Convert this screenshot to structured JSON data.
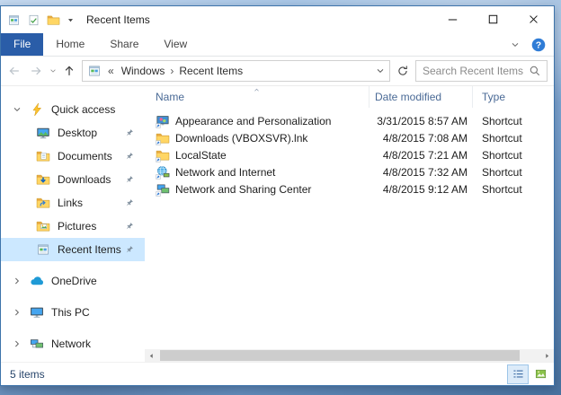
{
  "window": {
    "title": "Recent Items"
  },
  "ribbon": {
    "tabs": [
      {
        "label": "File",
        "active": true
      },
      {
        "label": "Home",
        "active": false
      },
      {
        "label": "Share",
        "active": false
      },
      {
        "label": "View",
        "active": false
      }
    ]
  },
  "addressbar": {
    "overflow": "«",
    "crumb_separator": "›",
    "crumbs": [
      "Windows",
      "Recent Items"
    ],
    "search_placeholder": "Search Recent Items"
  },
  "sidebar": {
    "sections": [
      {
        "label": "Quick access",
        "icon": "lightning",
        "expanded": true,
        "children": [
          {
            "label": "Desktop",
            "icon": "desktop",
            "pinned": true
          },
          {
            "label": "Documents",
            "icon": "folder-doc",
            "pinned": true
          },
          {
            "label": "Downloads",
            "icon": "folder-down",
            "pinned": true
          },
          {
            "label": "Links",
            "icon": "folder-link",
            "pinned": true
          },
          {
            "label": "Pictures",
            "icon": "folder-pic",
            "pinned": true
          },
          {
            "label": "Recent Items",
            "icon": "recent",
            "pinned": true,
            "selected": true
          }
        ]
      },
      {
        "label": "OneDrive",
        "icon": "cloud",
        "expanded": false
      },
      {
        "label": "This PC",
        "icon": "pc",
        "expanded": false
      },
      {
        "label": "Network",
        "icon": "network",
        "expanded": false
      }
    ]
  },
  "files": {
    "columns": [
      "Name",
      "Date modified",
      "Type"
    ],
    "sort_column": "Name",
    "sort_direction": "ascending",
    "rows": [
      {
        "name": "Appearance and Personalization",
        "icon": "appearance",
        "modified": "3/31/2015 8:57 AM",
        "type": "Shortcut"
      },
      {
        "name": "Downloads (VBOXSVR).lnk",
        "icon": "folder-sc",
        "modified": "4/8/2015 7:08 AM",
        "type": "Shortcut"
      },
      {
        "name": "LocalState",
        "icon": "folder-sc",
        "modified": "4/8/2015 7:21 AM",
        "type": "Shortcut"
      },
      {
        "name": "Network and Internet",
        "icon": "net-internet",
        "modified": "4/8/2015 7:32 AM",
        "type": "Shortcut"
      },
      {
        "name": "Network and Sharing Center",
        "icon": "net-share",
        "modified": "4/8/2015 9:12 AM",
        "type": "Shortcut"
      }
    ]
  },
  "statusbar": {
    "items_count": "5 items"
  },
  "icons": {
    "search": "magnifier",
    "refresh": "circular-arrow",
    "help": "question-mark-circle",
    "pin": "pushpin",
    "quick_access": "lightning-bolt",
    "onedrive": "cloud",
    "this_pc": "monitor",
    "network": "two-monitors",
    "sort": "chevron-up",
    "shortcut_overlay": "blue-arrow-box"
  },
  "colors": {
    "accent_blue": "#2a5da8",
    "selection_bg": "#cce8ff",
    "header_text": "#4a6a96",
    "wallpaper": "#7099c8"
  }
}
